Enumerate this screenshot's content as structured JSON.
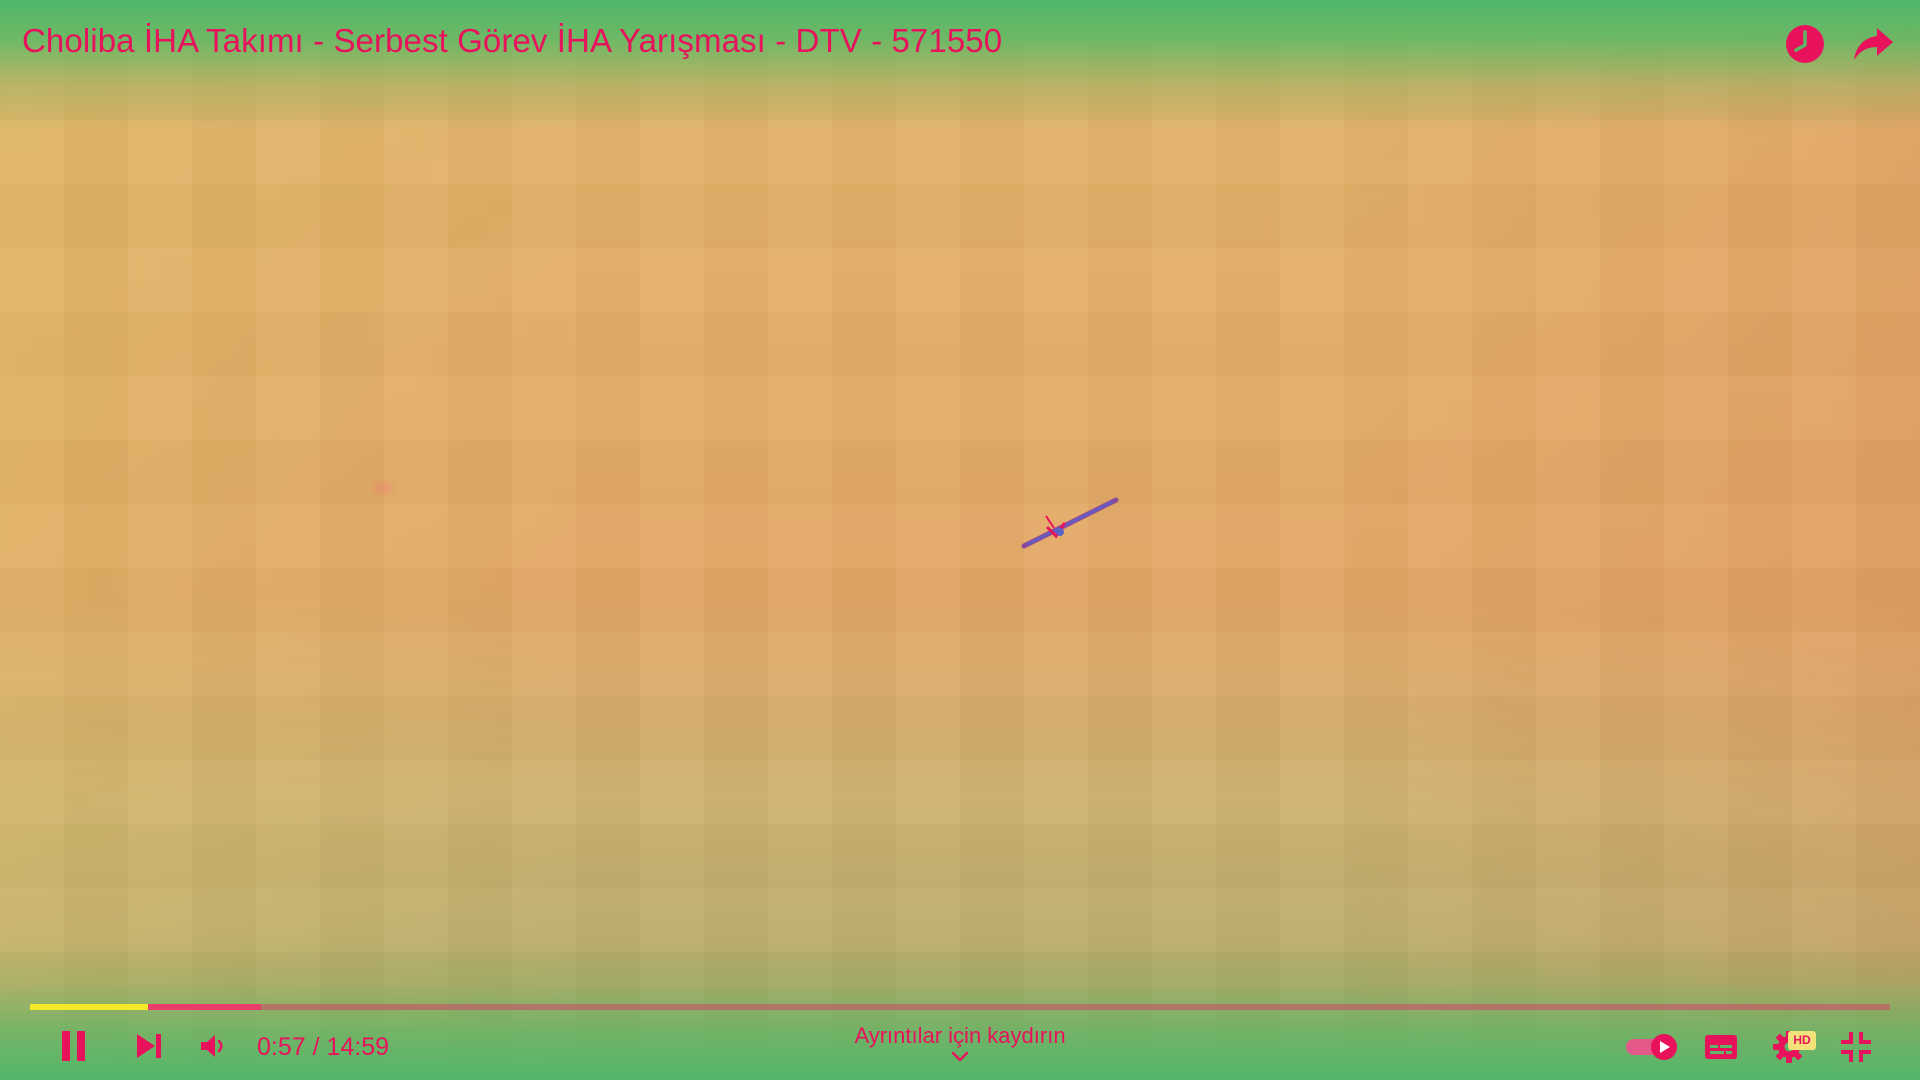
{
  "video": {
    "title": "Choliba İHA Takımı - Serbest Görev İHA Yarışması - DTV - 571550",
    "current_time": "0:57",
    "time_separator": " / ",
    "duration": "14:59",
    "played_fraction": 0.0634,
    "buffered_fraction": 0.124
  },
  "overlay": {
    "details_hint": "Ayrıntılar için kaydırın"
  },
  "controls": {
    "hd_badge": "HD",
    "autoplay_on": true
  },
  "icons": {
    "watch_later": "clock-icon",
    "share": "share-arrow-icon",
    "play_pause": "pause-icon",
    "next": "next-icon",
    "volume": "volume-icon",
    "autoplay": "autoplay-toggle-icon",
    "captions": "captions-icon",
    "settings": "gear-icon",
    "fullscreen_exit": "exit-fullscreen-icon"
  },
  "colors": {
    "accent": "#e8125c",
    "played": "#f5ea2a",
    "top_bar": "#4fb86a",
    "video_bg": "#e3ad68"
  }
}
